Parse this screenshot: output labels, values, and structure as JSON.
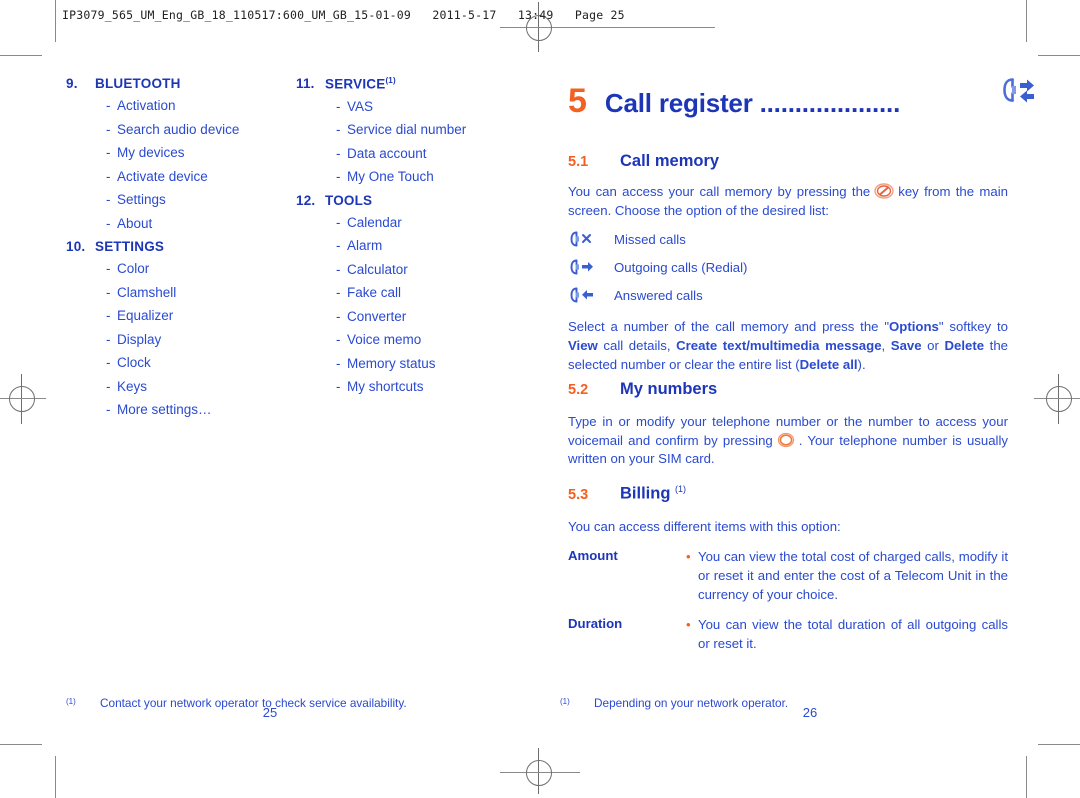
{
  "slug": "IP3079_565_UM_Eng_GB_18_110517:600_UM_GB_15-01-09   2011-5-17   13:49   Page 25",
  "colors": {
    "blue_heading": "#1d36b8",
    "blue_body": "#2a4ad0",
    "orange": "#f26122",
    "crop_mark": "#8a8a8a"
  },
  "left_page": {
    "toc_columns": [
      {
        "sections": [
          {
            "number": "9.",
            "title": "BLUETOOTH",
            "superscript": "",
            "items": [
              "Activation",
              "Search audio device",
              "My devices",
              "Activate device",
              "Settings",
              "About"
            ]
          },
          {
            "number": "10.",
            "title": "SETTINGS",
            "superscript": "",
            "items": [
              "Color",
              "Clamshell",
              "Equalizer",
              "Display",
              "Clock",
              "Keys",
              "More settings…"
            ]
          }
        ]
      },
      {
        "sections": [
          {
            "number": "11.",
            "title": "SERVICE",
            "superscript": "(1)",
            "items": [
              "VAS",
              "Service dial number",
              "Data account",
              "My One Touch"
            ]
          },
          {
            "number": "12.",
            "title": "TOOLS",
            "superscript": "",
            "items": [
              "Calendar",
              "Alarm",
              "Calculator",
              "Fake call",
              "Converter",
              "Voice memo",
              "Memory status",
              "My shortcuts"
            ]
          }
        ]
      }
    ],
    "dash": "-",
    "footnote": {
      "mark": "(1)",
      "text": "Contact your network operator to check service availability."
    },
    "folio": "25"
  },
  "right_page": {
    "chapter": {
      "number": "5",
      "title": "Call register ....................",
      "icon": "call-register-icon"
    },
    "sections": {
      "call_memory": {
        "number": "5.1",
        "title": "Call memory",
        "superscript": "",
        "intro_before_key": "You can access your call memory by pressing the",
        "key_icon": "end-call-key-icon",
        "intro_after_key": "key from the main screen. Choose the option of the desired list:",
        "list": [
          {
            "icon": "missed-calls-icon",
            "label": "Missed calls"
          },
          {
            "icon": "outgoing-calls-icon",
            "label": "Outgoing calls (Redial)"
          },
          {
            "icon": "answered-calls-icon",
            "label": "Answered calls"
          }
        ],
        "options_paragraph_parts": [
          {
            "text": "Select a number of the call memory and press the \"",
            "bold": false
          },
          {
            "text": "Options",
            "bold": true
          },
          {
            "text": "\" softkey to ",
            "bold": false
          },
          {
            "text": "View",
            "bold": true
          },
          {
            "text": " call details, ",
            "bold": false
          },
          {
            "text": "Create text/multimedia message",
            "bold": true
          },
          {
            "text": ", ",
            "bold": false
          },
          {
            "text": "Save",
            "bold": true
          },
          {
            "text": " or ",
            "bold": false
          },
          {
            "text": "Delete",
            "bold": true
          },
          {
            "text": " the selected number or clear the entire list (",
            "bold": false
          },
          {
            "text": "Delete all",
            "bold": true
          },
          {
            "text": ").",
            "bold": false
          }
        ]
      },
      "my_numbers": {
        "number": "5.2",
        "title": "My numbers",
        "superscript": "",
        "text_before_key": "Type in or modify your telephone number or the number to access your voicemail and confirm by pressing",
        "key_icon": "ok-key-icon",
        "text_after_key": ". Your telephone number is usually written on your SIM card."
      },
      "billing": {
        "number": "5.3",
        "title": "Billing",
        "superscript": "(1)",
        "intro": "You can access different items with this option:",
        "bullet": "•",
        "rows": [
          {
            "term": "Amount",
            "definition": "You can view the total cost of charged calls, modify it or reset it and enter the cost of a Telecom Unit in the currency of your choice."
          },
          {
            "term": "Duration",
            "definition": "You can view the total duration of all outgoing calls or reset it."
          }
        ]
      }
    },
    "footnote": {
      "mark": "(1)",
      "text": "Depending on your network operator."
    },
    "folio": "26"
  }
}
